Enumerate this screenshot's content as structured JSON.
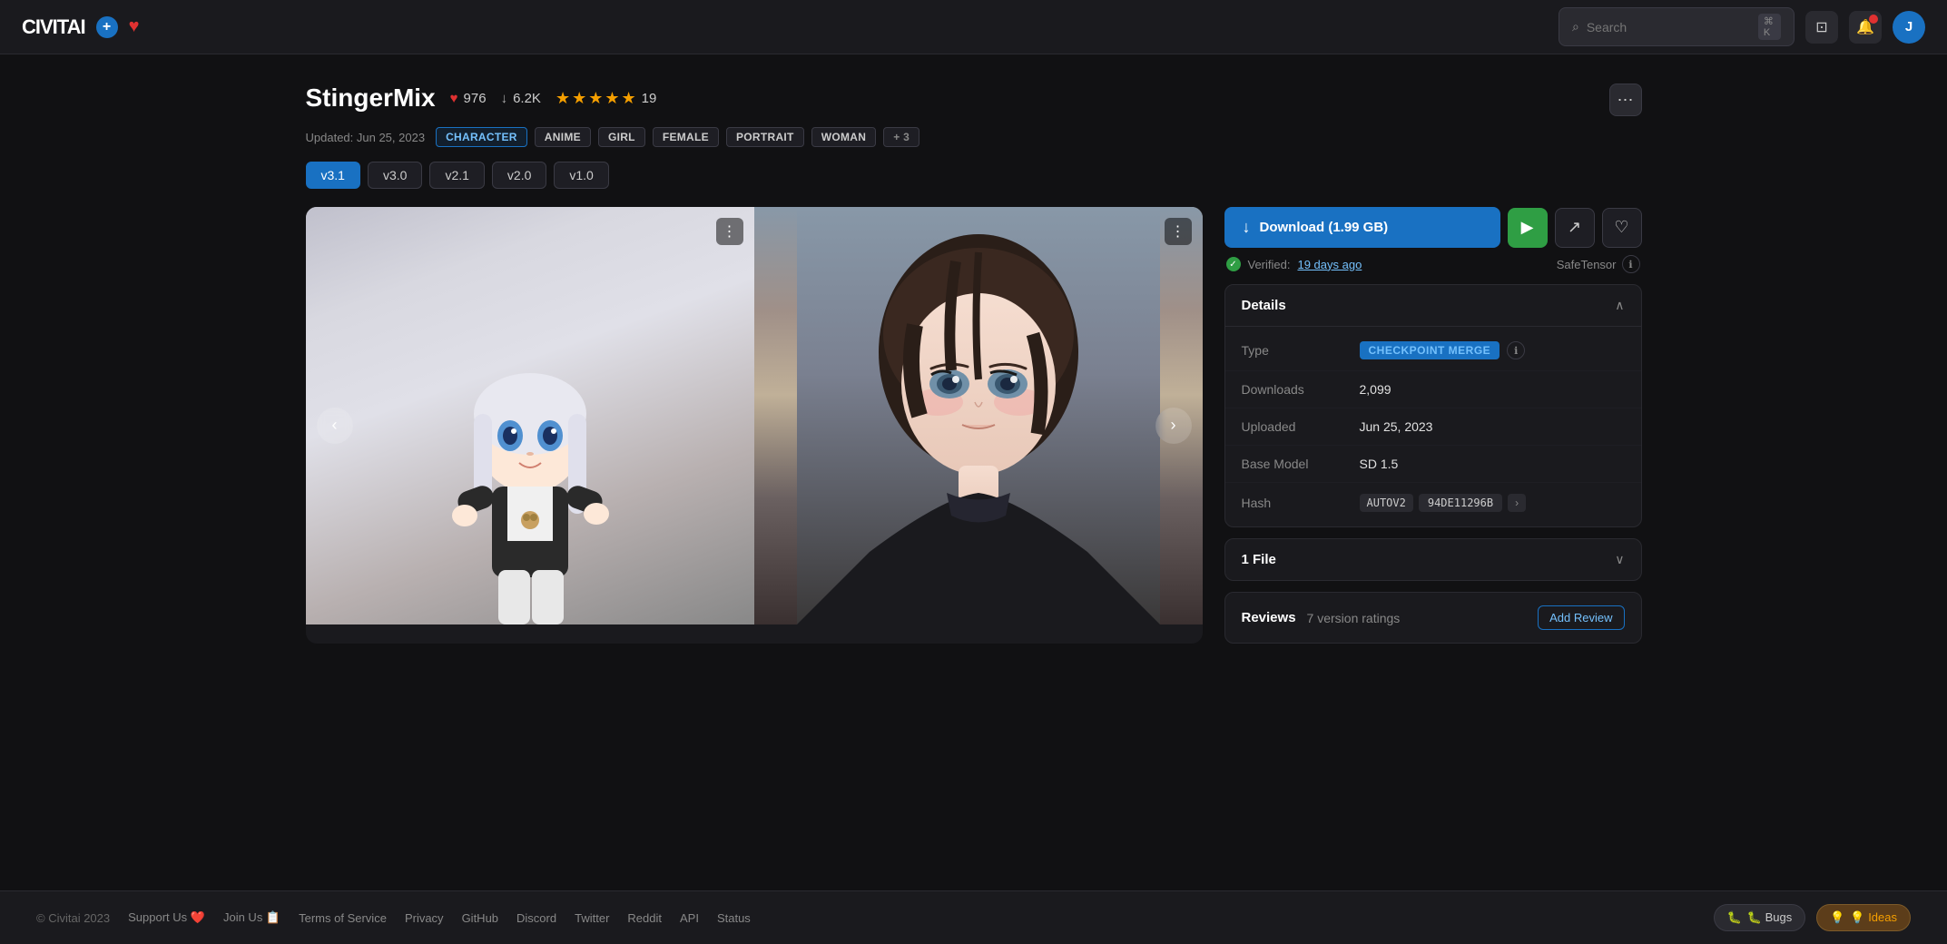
{
  "app": {
    "logo": "CIVITAI",
    "logo_plus": "+",
    "nav_avatar_initial": "J"
  },
  "search": {
    "placeholder": "Search",
    "shortcut": "⌘ K"
  },
  "model": {
    "title": "StingerMix",
    "likes": "976",
    "downloads": "6.2K",
    "rating_count": "19",
    "updated_text": "Updated: Jun 25, 2023",
    "tags": [
      "CHARACTER",
      "ANIME",
      "GIRL",
      "FEMALE",
      "PORTRAIT",
      "WOMAN",
      "+ 3"
    ],
    "versions": [
      "v3.1",
      "v3.0",
      "v2.1",
      "v2.0",
      "v1.0"
    ],
    "active_version": "v3.1"
  },
  "download": {
    "label": "Download (1.99 GB)",
    "safetensor_label": "SafeTensor"
  },
  "verified": {
    "label": "Verified:",
    "time": "19 days ago"
  },
  "details": {
    "section_title": "Details",
    "type_label": "Type",
    "type_value": "CHECKPOINT MERGE",
    "downloads_label": "Downloads",
    "downloads_value": "2,099",
    "uploaded_label": "Uploaded",
    "uploaded_value": "Jun 25, 2023",
    "base_model_label": "Base Model",
    "base_model_value": "SD 1.5",
    "hash_label": "Hash",
    "hash_badge": "AUTOV2",
    "hash_value": "94DE11296B"
  },
  "files": {
    "section_title": "1 File"
  },
  "reviews": {
    "section_title": "Reviews",
    "count_label": "7 version ratings",
    "add_review_label": "Add Review"
  },
  "footer": {
    "copyright": "© Civitai 2023",
    "links": [
      {
        "label": "Support Us ❤️",
        "id": "support-us"
      },
      {
        "label": "Join Us 📋",
        "id": "join-us"
      },
      {
        "label": "Terms of Service",
        "id": "terms"
      },
      {
        "label": "Privacy",
        "id": "privacy"
      },
      {
        "label": "GitHub",
        "id": "github"
      },
      {
        "label": "Discord",
        "id": "discord"
      },
      {
        "label": "Twitter",
        "id": "twitter"
      },
      {
        "label": "Reddit",
        "id": "reddit"
      },
      {
        "label": "API",
        "id": "api"
      },
      {
        "label": "Status",
        "id": "status"
      }
    ],
    "bugs_label": "🐛 Bugs",
    "ideas_label": "💡 Ideas"
  },
  "icons": {
    "heart": "♥",
    "download_arrow": "↓",
    "star": "★",
    "more": "⋯",
    "chevron_up": "∧",
    "chevron_down": "∨",
    "arrow_right": "›",
    "play": "▶",
    "share": "↗",
    "save": "♡",
    "search": "⌕",
    "screen": "⊡",
    "bell": "🔔",
    "check": "✓",
    "info": "ℹ",
    "prev": "‹",
    "next": "›",
    "options": "⋮",
    "bug": "🐛",
    "idea": "💡"
  }
}
